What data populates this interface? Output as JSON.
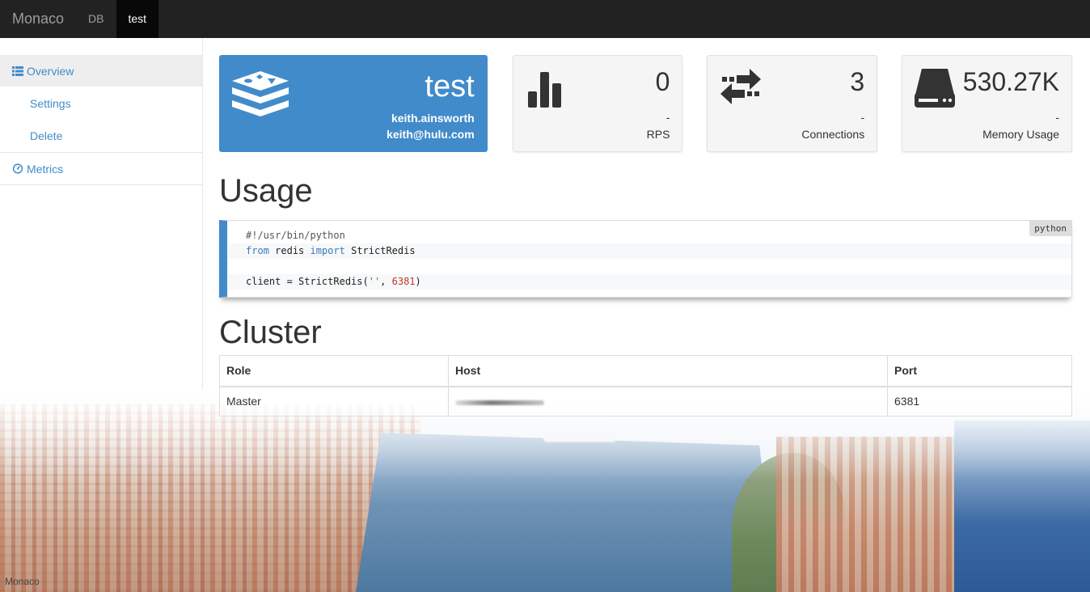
{
  "navbar": {
    "brand": "Monaco",
    "items": [
      {
        "label": "DB",
        "active": false
      },
      {
        "label": "test",
        "active": true
      }
    ]
  },
  "sidebar": {
    "overview": {
      "label": "Overview",
      "icon": "list-icon"
    },
    "sub_items": [
      {
        "label": "Settings"
      },
      {
        "label": "Delete"
      }
    ],
    "metrics": {
      "label": "Metrics",
      "icon": "dashboard-icon"
    }
  },
  "db_card": {
    "name": "test",
    "owner": "keith.ainsworth",
    "email": "keith@hulu.com",
    "icon": "redis-logo-icon",
    "color": "#428bca"
  },
  "stats": [
    {
      "value": "0",
      "sub": "-",
      "label": "RPS",
      "icon": "bar-chart-icon"
    },
    {
      "value": "3",
      "sub": "-",
      "label": "Connections",
      "icon": "exchange-icon"
    },
    {
      "value": "530.27K",
      "sub": "-",
      "label": "Memory Usage",
      "icon": "hdd-icon"
    }
  ],
  "usage": {
    "heading": "Usage",
    "language": "python",
    "code": {
      "shebang": "#!/usr/bin/python",
      "import_from": "from",
      "import_module": "redis",
      "import_kw": "import",
      "import_name": "StrictRedis",
      "client_prefix": "client = StrictRedis(",
      "client_host": "''",
      "client_sep": ", ",
      "client_port": "6381",
      "client_suffix": ")"
    }
  },
  "cluster": {
    "heading": "Cluster",
    "columns": [
      "Role",
      "Host",
      "Port"
    ],
    "rows": [
      {
        "role": "Master",
        "host": "",
        "port": "6381"
      }
    ]
  },
  "background_caption": "Monaco"
}
